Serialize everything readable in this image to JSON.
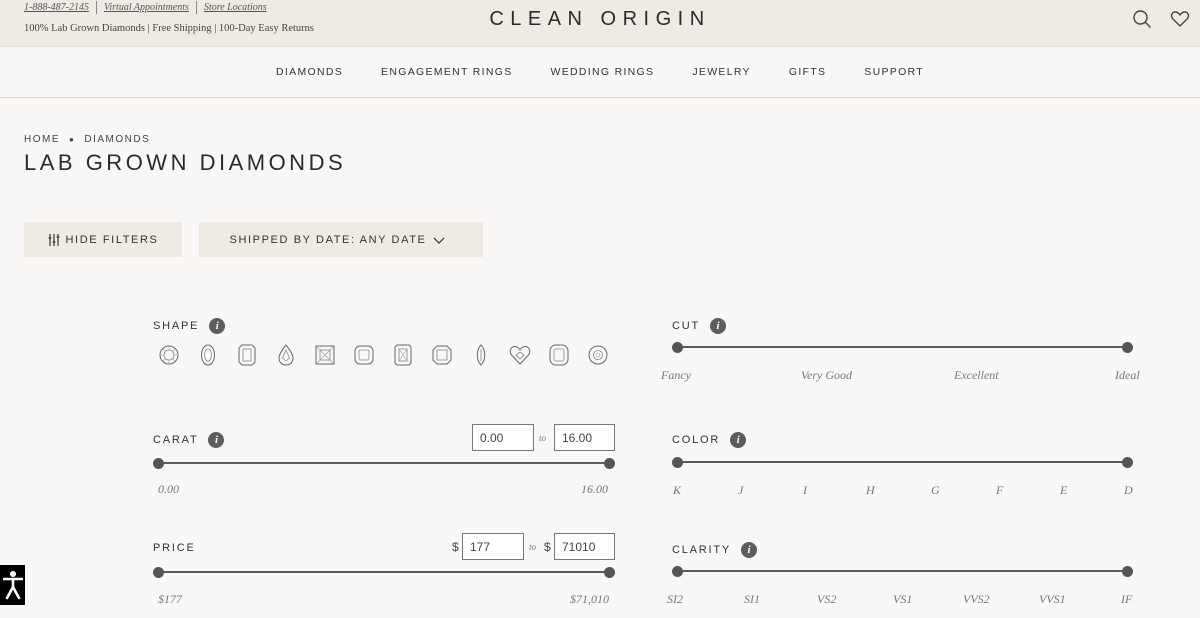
{
  "topbar": {
    "phone": "1-888-487-2145",
    "virtual": "Virtual Appointments",
    "stores": "Store Locations",
    "tagline": "100% Lab Grown Diamonds | Free Shipping | 100-Day Easy Returns",
    "logo": "CLEAN ORIGIN"
  },
  "nav": [
    "DIAMONDS",
    "ENGAGEMENT RINGS",
    "WEDDING RINGS",
    "JEWELRY",
    "GIFTS",
    "SUPPORT"
  ],
  "breadcrumb": {
    "home": "HOME",
    "current": "DIAMONDS"
  },
  "page_title": "LAB GROWN DIAMONDS",
  "buttons": {
    "hide_filters": "HIDE FILTERS",
    "shipped_by": "SHIPPED BY DATE: ANY DATE"
  },
  "filters": {
    "shape": {
      "label": "SHAPE",
      "shapes": [
        "round",
        "oval",
        "emerald",
        "pear",
        "princess",
        "cushion",
        "radiant",
        "asscher",
        "marquise",
        "heart",
        "elongated-cushion",
        "old-mine"
      ]
    },
    "cut": {
      "label": "CUT",
      "ticks": [
        "Fancy",
        "Very Good",
        "Excellent",
        "Ideal"
      ]
    },
    "carat": {
      "label": "CARAT",
      "min": "0.00",
      "max": "16.00",
      "to": "to",
      "min_label": "0.00",
      "max_label": "16.00"
    },
    "color": {
      "label": "COLOR",
      "ticks": [
        "K",
        "J",
        "I",
        "H",
        "G",
        "F",
        "E",
        "D"
      ]
    },
    "price": {
      "label": "PRICE",
      "currency": "$",
      "min": "177",
      "max": "71010",
      "to": "to",
      "min_label": "$177",
      "max_label": "$71,010"
    },
    "clarity": {
      "label": "CLARITY",
      "ticks": [
        "SI2",
        "SI1",
        "VS2",
        "VS1",
        "VVS2",
        "VVS1",
        "IF"
      ]
    }
  },
  "info_glyph": "i"
}
